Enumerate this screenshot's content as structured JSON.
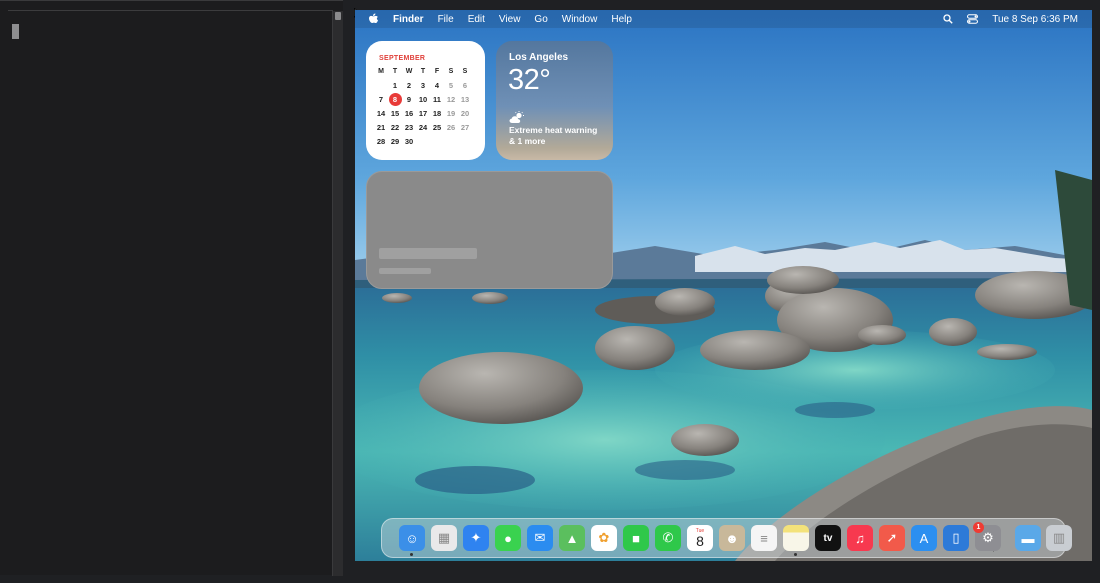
{
  "menubar": {
    "app_name": "Finder",
    "menus": [
      "File",
      "Edit",
      "View",
      "Go",
      "Window",
      "Help"
    ],
    "datetime": "Tue 8 Sep  6:36 PM"
  },
  "calendar": {
    "month": "SEPTEMBER",
    "weekdays": [
      "M",
      "T",
      "W",
      "T",
      "F",
      "S",
      "S"
    ],
    "weeks": [
      [
        "",
        "1",
        "2",
        "3",
        "4",
        "5",
        "6"
      ],
      [
        "7",
        "8",
        "9",
        "10",
        "11",
        "12",
        "13"
      ],
      [
        "14",
        "15",
        "16",
        "17",
        "18",
        "19",
        "20"
      ],
      [
        "21",
        "22",
        "23",
        "24",
        "25",
        "26",
        "27"
      ],
      [
        "28",
        "29",
        "30",
        "",
        "",
        "",
        ""
      ]
    ],
    "today": "8"
  },
  "weather": {
    "city": "Los Angeles",
    "temperature": "32°",
    "icon": "sun-behind-cloud-icon",
    "alert": "Extreme heat warning & 1 more"
  },
  "dock": {
    "apps": [
      {
        "name": "finder",
        "icon": "finder-icon",
        "color": "#3b8fe8",
        "running": true
      },
      {
        "name": "launchpad",
        "icon": "launchpad-icon",
        "color": "#e9e9ea",
        "running": false
      },
      {
        "name": "safari",
        "icon": "safari-icon",
        "color": "#2f83f0",
        "running": false
      },
      {
        "name": "messages",
        "icon": "messages-icon",
        "color": "#3ad24f",
        "running": false
      },
      {
        "name": "mail",
        "icon": "mail-icon",
        "color": "#2b8cf0",
        "running": false
      },
      {
        "name": "maps",
        "icon": "maps-icon",
        "color": "#5bbf5e",
        "running": false
      },
      {
        "name": "photos",
        "icon": "photos-icon",
        "color": "#ffffff",
        "running": false
      },
      {
        "name": "facetime",
        "icon": "facetime-icon",
        "color": "#2fc84a",
        "running": false
      },
      {
        "name": "phone",
        "icon": "phone-icon",
        "color": "#2fc84a",
        "running": false
      },
      {
        "name": "calendar",
        "icon": "calendar-icon",
        "color": "#ffffff",
        "running": false,
        "label_top": "Tue",
        "label_day": "8"
      },
      {
        "name": "contacts",
        "icon": "contacts-icon",
        "color": "#c8b89a",
        "running": false
      },
      {
        "name": "reminders",
        "icon": "reminders-icon",
        "color": "#f5f5f5",
        "running": false
      },
      {
        "name": "notes",
        "icon": "notes-icon",
        "color": "#f7f2c8",
        "running": true
      },
      {
        "name": "tv",
        "icon": "apple-tv-icon",
        "color": "#111111",
        "running": false,
        "label": "tv"
      },
      {
        "name": "music",
        "icon": "music-icon",
        "color": "#f7394f",
        "running": false
      },
      {
        "name": "rocket",
        "icon": "rocket-icon",
        "color": "#f25a4a",
        "running": false
      },
      {
        "name": "app-store",
        "icon": "app-store-icon",
        "color": "#2c8ff0",
        "running": false
      },
      {
        "name": "simulator",
        "icon": "simulator-icon",
        "color": "#2d7ad8",
        "running": false
      },
      {
        "name": "system-settings",
        "icon": "gear-icon",
        "color": "#8e8e93",
        "running": false,
        "badge": "1"
      },
      {
        "name": "downloads-folder",
        "icon": "folder-icon",
        "color": "#5aa8e8",
        "running": false
      },
      {
        "name": "trash",
        "icon": "trash-icon",
        "color": "#c9cdd2",
        "running": false
      }
    ]
  },
  "colors": {
    "menubar_text": "#ffffff",
    "calendar_today": "#e83a38",
    "calendar_month": "#e0403a",
    "terminal_bg": "#1c1c1e"
  }
}
